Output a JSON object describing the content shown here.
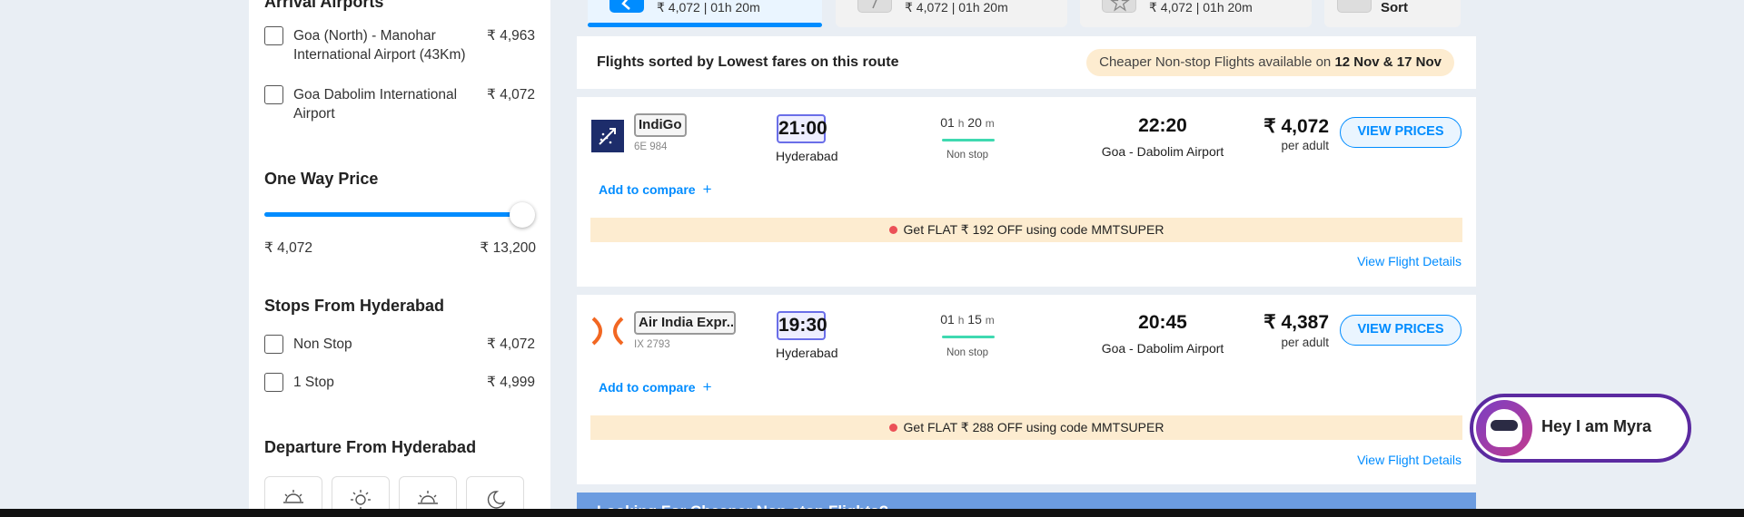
{
  "sidebar": {
    "partial_heading": "Arrival Airports",
    "airports": [
      {
        "label": "Goa (North) - Manohar International Airport (43Km)",
        "price": "₹ 4,963"
      },
      {
        "label": "Goa Dabolim International Airport",
        "price": "₹ 4,072"
      }
    ],
    "price_filter": {
      "title": "One Way Price",
      "min": "₹ 4,072",
      "max": "₹ 13,200",
      "level": 1.0
    },
    "stops_title": "Stops From Hyderabad",
    "stops": [
      {
        "label": "Non Stop",
        "price": "₹ 4,072"
      },
      {
        "label": "1 Stop",
        "price": "₹ 4,999"
      }
    ],
    "departure_title": "Departure From Hyderabad",
    "time_slots": [
      "sunrise-icon",
      "sun-icon",
      "sunset-icon",
      "moon-icon"
    ]
  },
  "tabs": [
    {
      "text": "₹ 4,072 | 01h 20m",
      "icon": "cheapest-icon",
      "active": true
    },
    {
      "text": "₹ 4,072 | 01h 20m",
      "icon": "fastest-icon",
      "active": false
    },
    {
      "text": "₹ 4,072 | 01h 20m",
      "icon": "star-icon",
      "active": false
    },
    {
      "text": "Sort",
      "icon": "sort-icon",
      "active": false
    }
  ],
  "sort_bar": {
    "title": "Flights sorted by Lowest fares on this route",
    "pill_text": "Cheaper Non-stop Flights available on ",
    "pill_dates": "12 Nov & 17 Nov"
  },
  "flights": [
    {
      "airline": "IndiGo",
      "code": "6E 984",
      "dep_time": "21:00",
      "dep_city": "Hyderabad",
      "dur_h": "01",
      "dur_m": "20",
      "stops": "Non stop",
      "arr_time": "22:20",
      "arr_city": "Goa - Dabolim Airport",
      "price": "₹ 4,072",
      "per": "per adult",
      "cta": "VIEW PRICES",
      "compare": "Add to compare",
      "promo": "Get FLAT ₹ 192 OFF using code MMTSUPER",
      "details": "View Flight Details"
    },
    {
      "airline": "Air India Expr...",
      "code": "IX 2793",
      "dep_time": "19:30",
      "dep_city": "Hyderabad",
      "dur_h": "01",
      "dur_m": "15",
      "stops": "Non stop",
      "arr_time": "20:45",
      "arr_city": "Goa - Dabolim Airport",
      "price": "₹ 4,387",
      "per": "per adult",
      "cta": "VIEW PRICES",
      "compare": "Add to compare",
      "promo": "Get FLAT ₹ 288 OFF using code MMTSUPER",
      "details": "View Flight Details"
    }
  ],
  "duration_units": {
    "h": "h",
    "m": "m"
  },
  "compare_plus": "+",
  "bottom_banner": "Looking For Cheaper Non-stop Flights?",
  "myra": {
    "text": "Hey I am Myra"
  },
  "colors": {
    "accent": "#008cff",
    "promo_bg": "#fdecd0",
    "myra_border": "#5b2aa0",
    "duration_line": "#3fd9b0"
  }
}
